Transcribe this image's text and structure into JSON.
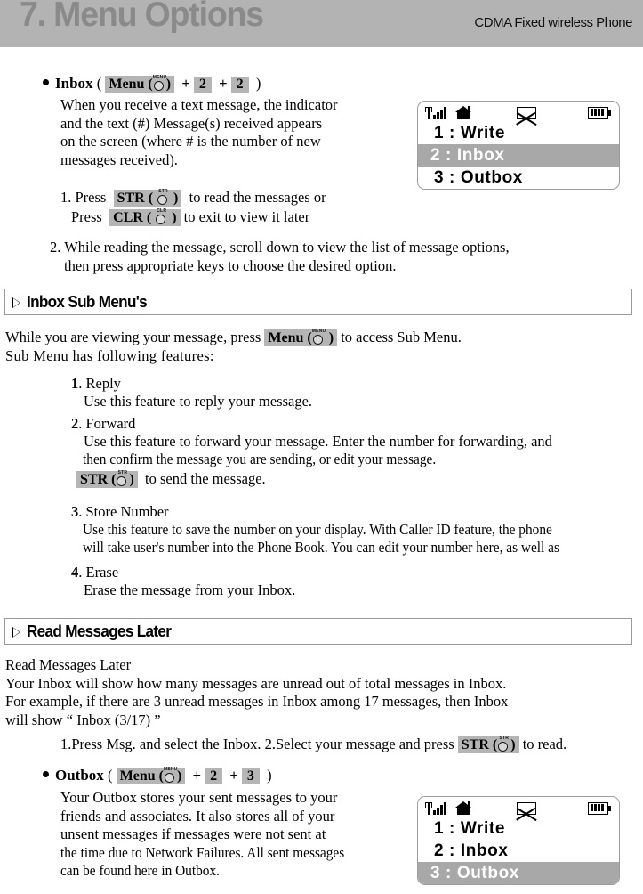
{
  "header": {
    "title": "7. Menu Options",
    "subtitle": "CDMA Fixed wireless Phone"
  },
  "inbox_section": {
    "heading_label": "Inbox",
    "paren_open": "(",
    "paren_close": ")",
    "plus": "+",
    "menu_key": {
      "label": "Menu",
      "micro": "MENU"
    },
    "key_2a": "2",
    "key_2b": "2",
    "desc_lines": [
      "When you receive a text message, the indicator",
      "and the text (#)  Message(s)  received appears",
      "on the screen (where #  is the number of new",
      "messages received)."
    ],
    "step1": {
      "num": "1. Press",
      "str_key": {
        "label": "STR",
        "micro": "STR"
      },
      "after_str": "to read the messages or",
      "press2": "Press",
      "clr_key": {
        "label": "CLR",
        "micro": "CLR"
      },
      "after_clr": "to exit to view it later"
    },
    "step2_lines": [
      "2. While reading the message, scroll down to view the list of message options,",
      "then press appropriate keys to choose the desired option."
    ]
  },
  "phone_display_1": {
    "icons": [
      "signal-icon",
      "home-icon",
      "envelope-icon",
      "battery-icon"
    ],
    "rows": [
      {
        "text": "1 : Write",
        "selected": false
      },
      {
        "text": "2 : Inbox",
        "selected": true
      },
      {
        "text": "3 : Outbox",
        "selected": false
      }
    ]
  },
  "sub_menu_section": {
    "title": "Inbox Sub Menu's",
    "intro_pre": "While you are viewing your message, press",
    "menu_key": {
      "label": "Menu",
      "micro": "MENU"
    },
    "intro_post": "to access Sub Menu.",
    "intro_line2": "Sub Menu has following features:",
    "items": [
      {
        "num": "1",
        "dot": ".",
        "title": "Reply",
        "lines": [
          "Use this feature to reply your message."
        ]
      },
      {
        "num": "2",
        "dot": ".",
        "title": "Forward",
        "lines": [
          "Use this feature to forward your message. Enter the number for forwarding, and",
          "then confirm the message you are sending, or edit your message."
        ],
        "str_key": {
          "label": "STR",
          "micro": "STR"
        },
        "str_after": "to send the message."
      },
      {
        "num": "3",
        "dot": ".",
        "title": "Store Number",
        "lines": [
          "Use this feature to save the number on your display. With Caller ID feature, the phone",
          "will take user's number into the Phone Book. You can edit your number here, as well as"
        ]
      },
      {
        "num": "4",
        "dot": ".",
        "title": "Erase",
        "lines": [
          "Erase the message from your Inbox."
        ]
      }
    ]
  },
  "read_later_section": {
    "title": "Read Messages Later",
    "lines": [
      "Read Messages Later",
      "Your Inbox will show how many messages are unread out of total messages in Inbox.",
      "For example, if there are 3 unread messages in Inbox among 17 messages, then Inbox",
      "will show “ Inbox (3/17) ”"
    ],
    "steps_pre": "1.Press Msg. and select the Inbox. 2.Select your message and press",
    "str_key": {
      "label": "STR",
      "micro": "STR"
    },
    "steps_post": "to read."
  },
  "outbox_section": {
    "heading_label": "Outbox",
    "paren_open": "(",
    "paren_close": ")",
    "plus": "+",
    "menu_key": {
      "label": "Menu",
      "micro": "MENU"
    },
    "key_2": "2",
    "key_3": "3",
    "desc_lines": [
      "Your Outbox stores your sent messages to your",
      "friends and associates. It also stores all of your",
      "unsent messages if messages were not sent at",
      "the time due to Network Failures. All sent messages",
      "can be found here in Outbox."
    ]
  },
  "phone_display_2": {
    "icons": [
      "signal-icon",
      "home-icon",
      "envelope-icon",
      "battery-icon"
    ],
    "rows": [
      {
        "text": "1 : Write",
        "selected": false
      },
      {
        "text": "2 : Inbox",
        "selected": false
      },
      {
        "text": "3 : Outbox",
        "selected": true
      }
    ]
  },
  "colors": {
    "header_band": "#b3b3b3",
    "header_title": "#8a8a8a",
    "chip_bg": "#b5b5b5",
    "highlight": "#a8a8a8",
    "box_border": "#9a9a9a"
  }
}
